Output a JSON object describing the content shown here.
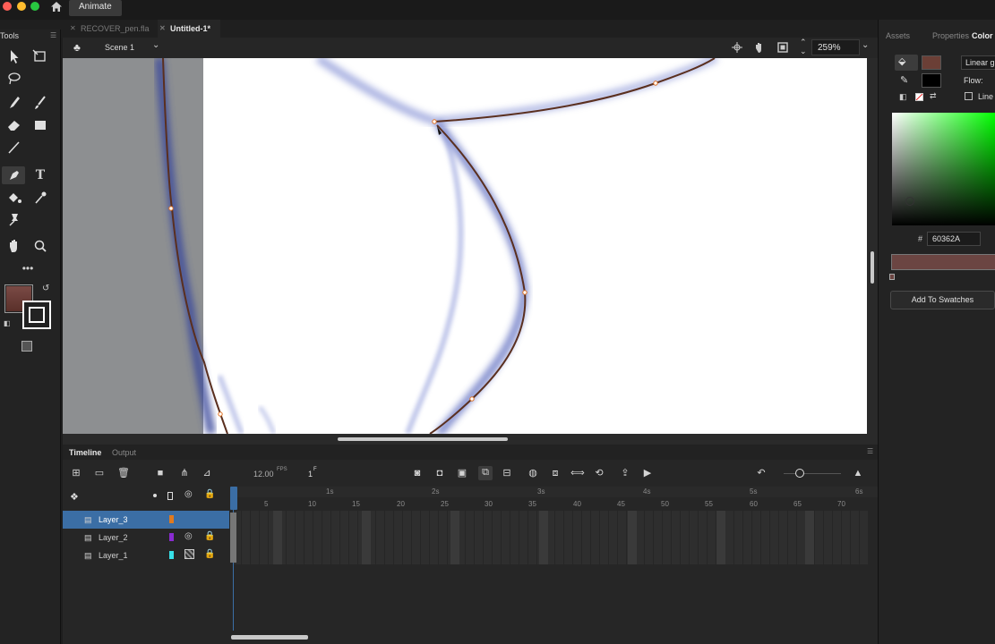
{
  "app": {
    "name": "Animate"
  },
  "doc_tabs": [
    {
      "label": "RECOVER_pen.fla",
      "active": false
    },
    {
      "label": "Untitled-1*",
      "active": true
    }
  ],
  "tools_panel": {
    "title": "Tools"
  },
  "scene": {
    "label": "Scene 1",
    "zoom": "259%"
  },
  "timeline": {
    "tabs": [
      "Timeline",
      "Output"
    ],
    "fps_value": "12.00",
    "fps_unit": "FPS",
    "frame": "1",
    "frame_suffix": "F",
    "seconds": [
      "1s",
      "2s",
      "3s",
      "4s",
      "5s",
      "6s"
    ],
    "frame_numbers": [
      "5",
      "10",
      "15",
      "20",
      "25",
      "30",
      "35",
      "40",
      "45",
      "50",
      "55",
      "60",
      "65",
      "70"
    ],
    "layers": [
      {
        "name": "Layer_3",
        "color": "#e07a1f",
        "selected": true
      },
      {
        "name": "Layer_2",
        "color": "#8a2bd1",
        "selected": false
      },
      {
        "name": "Layer_1",
        "color": "#37e0e8",
        "selected": false
      }
    ]
  },
  "right_panel": {
    "tabs": [
      "Assets",
      "Properties",
      "Color"
    ],
    "gradient_type": "Linear g",
    "flow_label": "Flow:",
    "linear_rgb_label": "Line",
    "hex_prefix": "#",
    "hex_value": "60362A",
    "add_swatch": "Add To Swatches"
  },
  "colors": {
    "fill": "#60362A",
    "stroke": "#000000",
    "accent": "#3b6ea5"
  }
}
